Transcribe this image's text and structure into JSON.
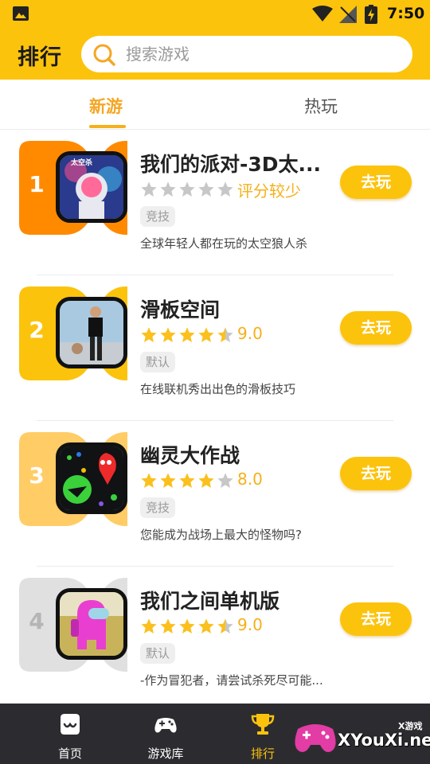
{
  "status_bar": {
    "time": "7:50"
  },
  "header": {
    "title": "排行",
    "search_placeholder": "搜索游戏"
  },
  "tabs": [
    {
      "label": "新游",
      "active": true
    },
    {
      "label": "热玩",
      "active": false
    }
  ],
  "games": [
    {
      "rank": "1",
      "title": "我们的派对-3D太...",
      "rating": 0,
      "score": "评分较少",
      "tag": "竞技",
      "desc": "全球年轻人都在玩的太空狼人杀",
      "button": "去玩"
    },
    {
      "rank": "2",
      "title": "滑板空间",
      "rating": 4.5,
      "score": "9.0",
      "tag": "默认",
      "desc": "在线联机秀出出色的滑板技巧",
      "button": "去玩"
    },
    {
      "rank": "3",
      "title": "幽灵大作战",
      "rating": 4,
      "score": "8.0",
      "tag": "竞技",
      "desc": "您能成为战场上最大的怪物吗?",
      "button": "去玩"
    },
    {
      "rank": "4",
      "title": "我们之间单机版",
      "rating": 4.5,
      "score": "9.0",
      "tag": "默认",
      "desc": "-作为冒犯者，请尝试杀死尽可能...",
      "button": "去玩"
    }
  ],
  "bottom_nav": [
    {
      "label": "首页",
      "icon": "home-icon"
    },
    {
      "label": "游戏库",
      "icon": "gamepad-icon"
    },
    {
      "label": "排行",
      "icon": "trophy-icon",
      "active": true
    }
  ],
  "watermark": {
    "small": "X游戏",
    "big": "XYouXi.net"
  },
  "colors": {
    "accent": "#fcc30d",
    "rank1": "#ff8a00",
    "rank2": "#fcc30d",
    "rank3": "#ffcc66",
    "rank4": "#e0e0e0"
  }
}
